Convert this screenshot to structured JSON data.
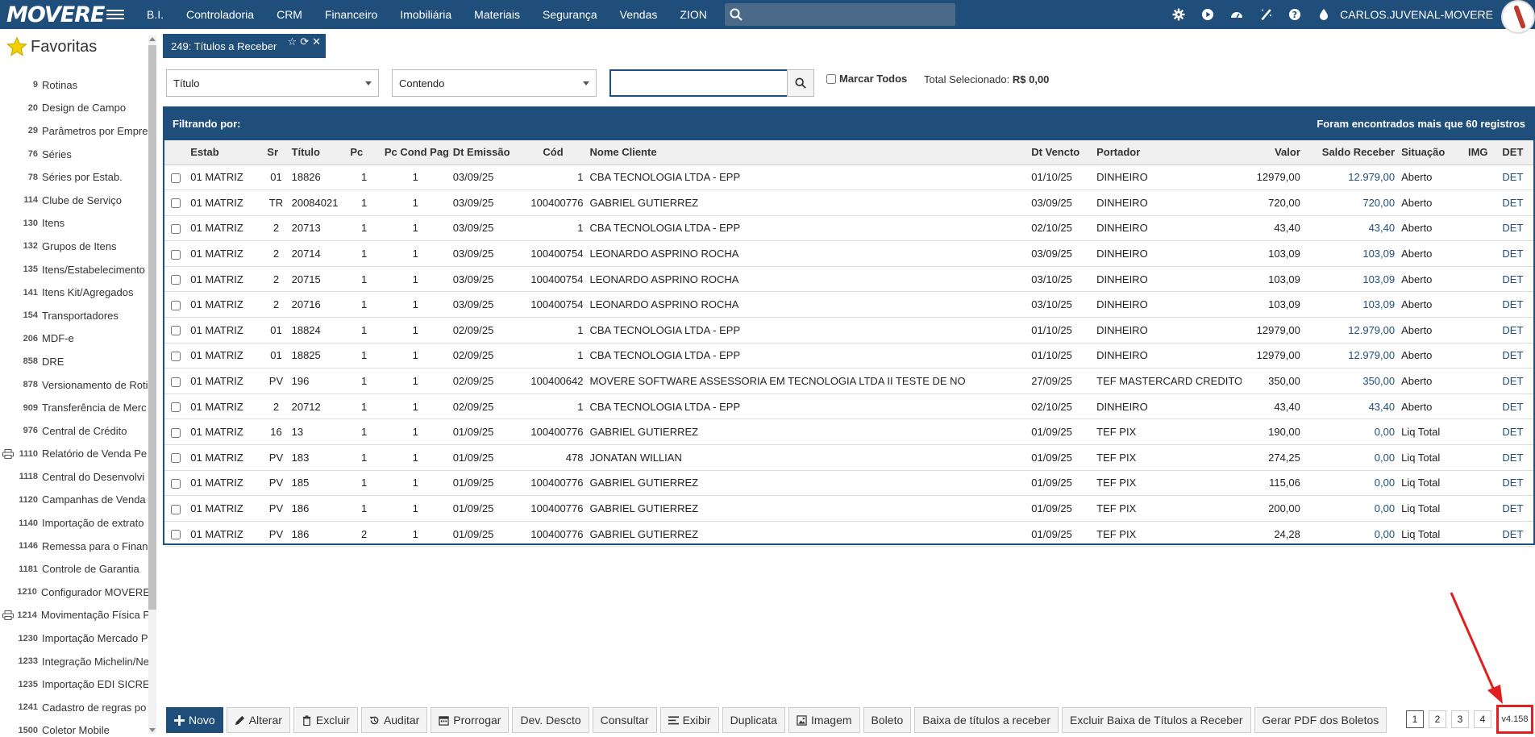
{
  "topbar": {
    "logo": "MOVERE",
    "menu": [
      "B.I.",
      "Controladoria",
      "CRM",
      "Financeiro",
      "Imobiliária",
      "Materiais",
      "Segurança",
      "Vendas",
      "ZION"
    ],
    "search_placeholder": "",
    "user_name": "CARLOS.JUVENAL-MOVERE",
    "icons": [
      "gear-icon",
      "play-icon",
      "dashboard-icon",
      "magic-wand-icon",
      "help-icon",
      "drop-icon"
    ]
  },
  "sidebar": {
    "title": "Favoritas",
    "items": [
      {
        "num": "9",
        "label": "Rotinas",
        "print": false
      },
      {
        "num": "20",
        "label": "Design de Campo",
        "print": false
      },
      {
        "num": "29",
        "label": "Parâmetros por Empre",
        "print": false
      },
      {
        "num": "76",
        "label": "Séries",
        "print": false
      },
      {
        "num": "78",
        "label": "Séries por Estab.",
        "print": false
      },
      {
        "num": "114",
        "label": "Clube de Serviço",
        "print": false
      },
      {
        "num": "130",
        "label": "Itens",
        "print": false
      },
      {
        "num": "132",
        "label": "Grupos de Itens",
        "print": false
      },
      {
        "num": "135",
        "label": "Itens/Estabelecimento",
        "print": false
      },
      {
        "num": "141",
        "label": "Itens Kit/Agregados",
        "print": false
      },
      {
        "num": "154",
        "label": "Transportadores",
        "print": false
      },
      {
        "num": "206",
        "label": "MDF-e",
        "print": false
      },
      {
        "num": "858",
        "label": "DRE",
        "print": false
      },
      {
        "num": "878",
        "label": "Versionamento de Roti",
        "print": false
      },
      {
        "num": "909",
        "label": "Transferência de Merc",
        "print": false
      },
      {
        "num": "976",
        "label": "Central de Crédito",
        "print": false
      },
      {
        "num": "1110",
        "label": "Relatório de Venda Pe",
        "print": true
      },
      {
        "num": "1118",
        "label": "Central do Desenvolvi",
        "print": false
      },
      {
        "num": "1120",
        "label": "Campanhas de Venda",
        "print": false
      },
      {
        "num": "1140",
        "label": "Importação de extrato",
        "print": false
      },
      {
        "num": "1146",
        "label": "Remessa para o Finan",
        "print": false
      },
      {
        "num": "1181",
        "label": "Controle de Garantia",
        "print": false
      },
      {
        "num": "1210",
        "label": "Configurador MOVERE",
        "print": false
      },
      {
        "num": "1214",
        "label": "Movimentação Física P",
        "print": true
      },
      {
        "num": "1230",
        "label": "Importação Mercado P",
        "print": false
      },
      {
        "num": "1233",
        "label": "Integração Michelin/Ne",
        "print": false
      },
      {
        "num": "1235",
        "label": "Importação EDI SICRE",
        "print": false
      },
      {
        "num": "1241",
        "label": "Cadastro de regras po",
        "print": false
      },
      {
        "num": "1500",
        "label": "Coletor Mobile",
        "print": false
      }
    ]
  },
  "tab": {
    "label": "249: Títulos a Receber",
    "icons": [
      "star-icon",
      "refresh-icon",
      "close-icon"
    ]
  },
  "filter": {
    "field_select": "Título",
    "operator_select": "Contendo",
    "search_value": "",
    "mark_all_label": "Marcar Todos",
    "total_label": "Total Selecionado:",
    "total_value": "R$ 0,00"
  },
  "grid": {
    "filter_label": "Filtrando por:",
    "count_label": "Foram encontrados mais que 60 registros",
    "columns": [
      "",
      "Estab",
      "Sr",
      "Título",
      "Pc",
      "Pc Cond Pag",
      "Dt Emissão",
      "Cód",
      "Nome Cliente",
      "Dt Vencto",
      "Portador",
      "Valor",
      "Saldo Receber",
      "Situação",
      "IMG",
      "DET"
    ],
    "rows": [
      [
        "01 MATRIZ",
        "01",
        "18826",
        "1",
        "1",
        "03/09/25",
        "1",
        "CBA TECNOLOGIA LTDA - EPP",
        "01/10/25",
        "DINHEIRO",
        "12979,00",
        "12.979,00",
        "Aberto",
        "",
        "DET"
      ],
      [
        "01 MATRIZ",
        "TR",
        "20084021",
        "1",
        "1",
        "03/09/25",
        "100400776",
        "GABRIEL GUTIERREZ",
        "03/09/25",
        "DINHEIRO",
        "720,00",
        "720,00",
        "Aberto",
        "",
        "DET"
      ],
      [
        "01 MATRIZ",
        "2",
        "20713",
        "1",
        "1",
        "03/09/25",
        "1",
        "CBA TECNOLOGIA LTDA - EPP",
        "02/10/25",
        "DINHEIRO",
        "43,40",
        "43,40",
        "Aberto",
        "",
        "DET"
      ],
      [
        "01 MATRIZ",
        "2",
        "20714",
        "1",
        "1",
        "03/09/25",
        "100400754",
        "LEONARDO ASPRINO ROCHA",
        "03/09/25",
        "DINHEIRO",
        "103,09",
        "103,09",
        "Aberto",
        "",
        "DET"
      ],
      [
        "01 MATRIZ",
        "2",
        "20715",
        "1",
        "1",
        "03/09/25",
        "100400754",
        "LEONARDO ASPRINO ROCHA",
        "03/10/25",
        "DINHEIRO",
        "103,09",
        "103,09",
        "Aberto",
        "",
        "DET"
      ],
      [
        "01 MATRIZ",
        "2",
        "20716",
        "1",
        "1",
        "03/09/25",
        "100400754",
        "LEONARDO ASPRINO ROCHA",
        "03/10/25",
        "DINHEIRO",
        "103,09",
        "103,09",
        "Aberto",
        "",
        "DET"
      ],
      [
        "01 MATRIZ",
        "01",
        "18824",
        "1",
        "1",
        "02/09/25",
        "1",
        "CBA TECNOLOGIA LTDA - EPP",
        "01/10/25",
        "DINHEIRO",
        "12979,00",
        "12.979,00",
        "Aberto",
        "",
        "DET"
      ],
      [
        "01 MATRIZ",
        "01",
        "18825",
        "1",
        "1",
        "02/09/25",
        "1",
        "CBA TECNOLOGIA LTDA - EPP",
        "01/10/25",
        "DINHEIRO",
        "12979,00",
        "12.979,00",
        "Aberto",
        "",
        "DET"
      ],
      [
        "01 MATRIZ",
        "PV",
        "196",
        "1",
        "1",
        "02/09/25",
        "100400642",
        "MOVERE SOFTWARE ASSESSORIA EM TECNOLOGIA LTDA II TESTE DE NO",
        "27/09/25",
        "TEF MASTERCARD CREDITO",
        "350,00",
        "350,00",
        "Aberto",
        "",
        "DET"
      ],
      [
        "01 MATRIZ",
        "2",
        "20712",
        "1",
        "1",
        "02/09/25",
        "1",
        "CBA TECNOLOGIA LTDA - EPP",
        "02/10/25",
        "DINHEIRO",
        "43,40",
        "43,40",
        "Aberto",
        "",
        "DET"
      ],
      [
        "01 MATRIZ",
        "16",
        "13",
        "1",
        "1",
        "01/09/25",
        "100400776",
        "GABRIEL GUTIERREZ",
        "01/09/25",
        "TEF PIX",
        "190,00",
        "0,00",
        "Liq Total",
        "",
        "DET"
      ],
      [
        "01 MATRIZ",
        "PV",
        "183",
        "1",
        "1",
        "01/09/25",
        "478",
        "JONATAN WILLIAN",
        "01/09/25",
        "TEF PIX",
        "274,25",
        "0,00",
        "Liq Total",
        "",
        "DET"
      ],
      [
        "01 MATRIZ",
        "PV",
        "185",
        "1",
        "1",
        "01/09/25",
        "100400776",
        "GABRIEL GUTIERREZ",
        "01/09/25",
        "TEF PIX",
        "115,06",
        "0,00",
        "Liq Total",
        "",
        "DET"
      ],
      [
        "01 MATRIZ",
        "PV",
        "186",
        "1",
        "1",
        "01/09/25",
        "100400776",
        "GABRIEL GUTIERREZ",
        "01/09/25",
        "TEF PIX",
        "200,00",
        "0,00",
        "Liq Total",
        "",
        "DET"
      ],
      [
        "01 MATRIZ",
        "PV",
        "186",
        "2",
        "1",
        "01/09/25",
        "100400776",
        "GABRIEL GUTIERREZ",
        "01/09/25",
        "TEF PIX",
        "24,28",
        "0,00",
        "Liq Total",
        "",
        "DET"
      ]
    ]
  },
  "toolbar": {
    "buttons": [
      {
        "label": "Novo",
        "icon": "plus-icon",
        "primary": true
      },
      {
        "label": "Alterar",
        "icon": "pencil-icon"
      },
      {
        "label": "Excluir",
        "icon": "trash-icon"
      },
      {
        "label": "Auditar",
        "icon": "history-icon"
      },
      {
        "label": "Prorrogar",
        "icon": "calendar-icon"
      },
      {
        "label": "Dev. Descto",
        "icon": ""
      },
      {
        "label": "Consultar",
        "icon": ""
      },
      {
        "label": "Exibir",
        "icon": "list-icon"
      },
      {
        "label": "Duplicata",
        "icon": ""
      },
      {
        "label": "Imagem",
        "icon": "image-icon"
      },
      {
        "label": "Boleto",
        "icon": ""
      },
      {
        "label": "Baixa de títulos a receber",
        "icon": ""
      },
      {
        "label": "Excluir Baixa de Títulos a Receber",
        "icon": ""
      },
      {
        "label": "Gerar PDF dos Boletos",
        "icon": ""
      }
    ]
  },
  "pager": {
    "pages": [
      "1",
      "2",
      "3",
      "4"
    ],
    "active": "1"
  },
  "version": "v4.158",
  "colors": {
    "brand": "#1f4e7a",
    "link": "#1f4e7a",
    "annotation": "#e02020"
  }
}
